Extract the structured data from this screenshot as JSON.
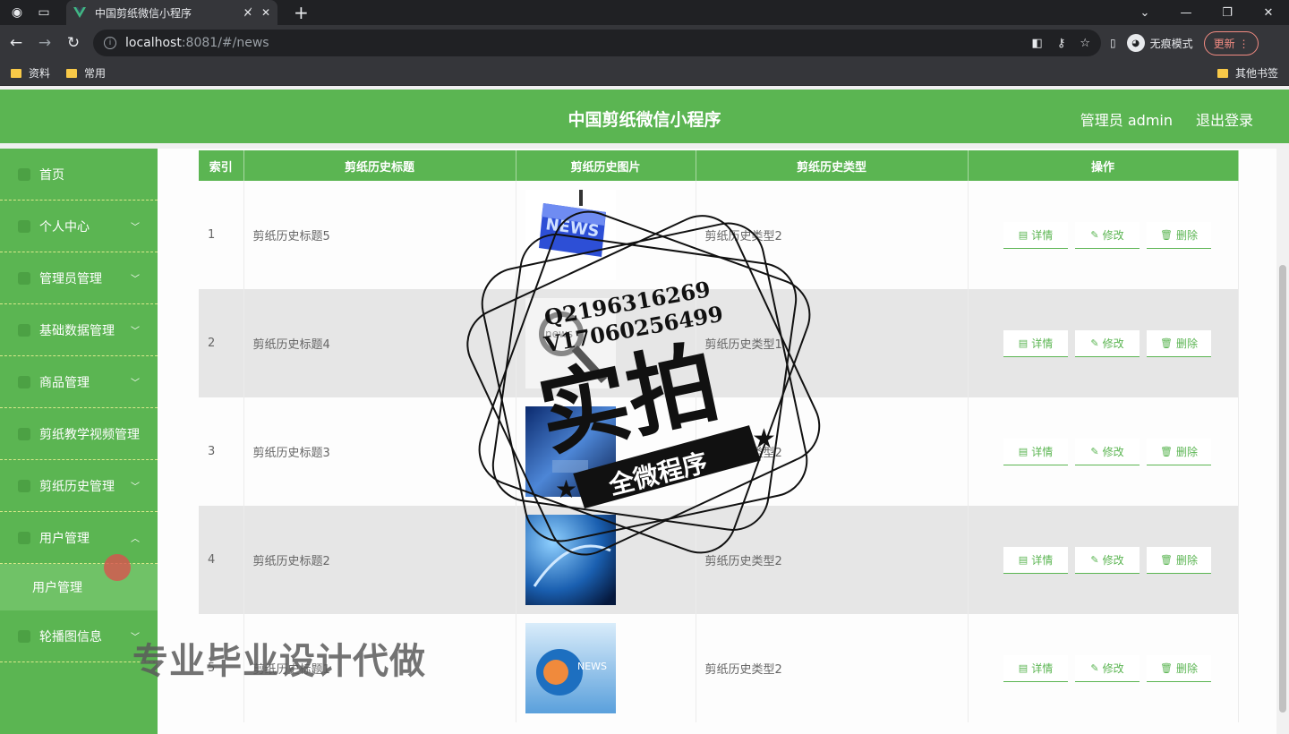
{
  "browser": {
    "tab_title": "中国剪纸微信小程序",
    "url_host": "localhost",
    "url_rest": ":8081/#/news",
    "incognito_label": "无痕模式",
    "update_label": "更新",
    "bookmarks": [
      "资料",
      "常用"
    ],
    "other_bookmarks": "其他书签"
  },
  "header": {
    "title": "中国剪纸微信小程序",
    "user": "管理员 admin",
    "logout": "退出登录"
  },
  "sidebar": {
    "items": [
      {
        "label": "首页",
        "has_arrow": false
      },
      {
        "label": "个人中心",
        "has_arrow": true
      },
      {
        "label": "管理员管理",
        "has_arrow": true
      },
      {
        "label": "基础数据管理",
        "has_arrow": true
      },
      {
        "label": "商品管理",
        "has_arrow": true
      },
      {
        "label": "剪纸教学视频管理",
        "has_arrow": false
      },
      {
        "label": "剪纸历史管理",
        "has_arrow": true
      },
      {
        "label": "用户管理",
        "has_arrow": true,
        "expanded": true
      },
      {
        "label": "轮播图信息",
        "has_arrow": true
      }
    ],
    "submenu": "用户管理"
  },
  "table": {
    "columns": [
      "索引",
      "剪纸历史标题",
      "剪纸历史图片",
      "剪纸历史类型",
      "操作"
    ],
    "rows": [
      {
        "index": "1",
        "title": "剪纸历史标题5",
        "type": "剪纸历史类型2"
      },
      {
        "index": "2",
        "title": "剪纸历史标题4",
        "type": "剪纸历史类型1"
      },
      {
        "index": "3",
        "title": "剪纸历史标题3",
        "type": "剪纸历史类型2"
      },
      {
        "index": "4",
        "title": "剪纸历史标题2",
        "type": "剪纸历史类型2"
      },
      {
        "index": "5",
        "title": "剪纸历史标题1",
        "type": "剪纸历史类型2"
      }
    ],
    "actions": {
      "detail": "详情",
      "edit": "修改",
      "delete": "删除"
    }
  },
  "watermark": {
    "line1": "Q2196316269",
    "line2": "V17060256499",
    "big": "实拍",
    "ribbon": "全微程序",
    "bottom": "专业毕业设计代做"
  },
  "colors": {
    "accent": "#5bb552",
    "alt_row": "#e6e6e6"
  }
}
